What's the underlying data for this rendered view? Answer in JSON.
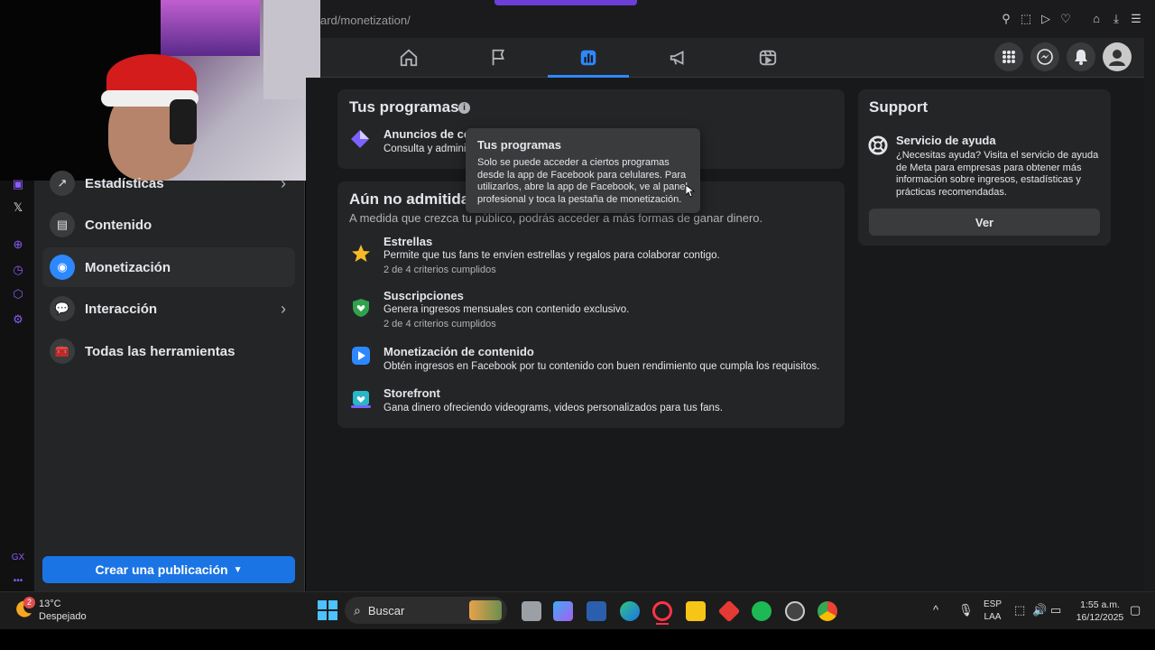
{
  "browser": {
    "url_fragment": "ard/monetization/"
  },
  "colors": {
    "accent": "#2d88ff",
    "primary_button": "#1b74e4",
    "surface": "#242526",
    "background": "#18191a",
    "opera_accent": "#8b5cf6"
  },
  "top_nav": {
    "tabs": [
      {
        "name": "home",
        "icon": "home-icon"
      },
      {
        "name": "pages",
        "icon": "flag-icon"
      },
      {
        "name": "dashboard",
        "icon": "bar-chart-icon",
        "active": true
      },
      {
        "name": "ads",
        "icon": "megaphone-icon"
      },
      {
        "name": "reels",
        "icon": "video-play-icon"
      }
    ],
    "right_icons": [
      "apps-grid-icon",
      "messenger-icon",
      "bell-icon",
      "profile-avatar"
    ]
  },
  "sidebar": {
    "items": [
      {
        "label": "Estadísticas",
        "icon": "chart-line-icon",
        "has_chevron": true
      },
      {
        "label": "Contenido",
        "icon": "content-icon"
      },
      {
        "label": "Monetización",
        "icon": "money-icon",
        "active": true
      },
      {
        "label": "Interacción",
        "icon": "chat-bubble-icon",
        "has_chevron": true
      },
      {
        "label": "Todas las herramientas",
        "icon": "toolbox-icon"
      }
    ],
    "create_button": "Crear una publicación"
  },
  "programs": {
    "title": "Tus programas",
    "item": {
      "title": "Anuncios de co",
      "desc": "Consulta y adminis"
    }
  },
  "tooltip": {
    "title": "Tus programas",
    "body": "Solo se puede acceder a ciertos programas desde la app de Facebook para celulares. Para utilizarlos, abre la app de Facebook, ve al panel profesional y toca la pestaña de monetización."
  },
  "not_admitted": {
    "title": "Aún no admitida",
    "subtitle": "A medida que crezca tu público, podrás acceder a más formas de ganar dinero.",
    "items": [
      {
        "title": "Estrellas",
        "desc": "Permite que tus fans te envíen estrellas y regalos para colaborar contigo.",
        "criteria": "2 de 4 criterios cumplidos",
        "icon": "star-icon"
      },
      {
        "title": "Suscripciones",
        "desc": "Genera ingresos mensuales con contenido exclusivo.",
        "criteria": "2 de 4 criterios cumplidos",
        "icon": "shield-heart-icon"
      },
      {
        "title": "Monetización de contenido",
        "desc": "Obtén ingresos en Facebook por tu contenido con buen rendimiento que cumpla los requisitos.",
        "criteria": "",
        "icon": "play-icon"
      },
      {
        "title": "Storefront",
        "desc": "Gana dinero ofreciendo videograms, videos personalizados para tus fans.",
        "criteria": "",
        "icon": "storefront-icon"
      }
    ]
  },
  "support": {
    "title": "Support",
    "item_title": "Servicio de ayuda",
    "item_desc": "¿Necesitas ayuda? Visita el servicio de ayuda de Meta para empresas para obtener más información sobre ingresos, estadísticas y prácticas recomendadas.",
    "button": "Ver"
  },
  "taskbar": {
    "weather_temp": "13°C",
    "weather_desc": "Despejado",
    "weather_badge": "2",
    "search_label": "Buscar",
    "lang_line1": "ESP",
    "lang_line2": "LAA",
    "time": "1:55 a.m.",
    "date": "16/12/2025"
  },
  "rail": {
    "gx_label": "GX"
  }
}
